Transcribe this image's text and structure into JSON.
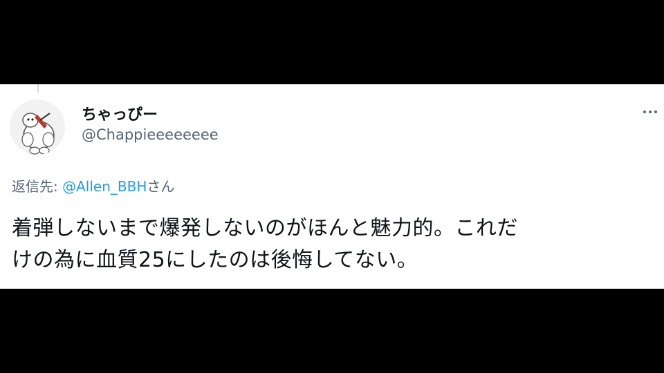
{
  "tweet": {
    "display_name": "ちゃっぴー",
    "handle": "@Chappieeeeeeee",
    "reply_prefix": "返信先: ",
    "reply_mention": "@Allen_BBH",
    "reply_suffix": "さん",
    "text_lines": [
      "着弾しないまで爆発しないのがほんと魅力的。これだ",
      "けの為に血質25にしたのは後悔してない。"
    ]
  },
  "colors": {
    "background": "#000000",
    "card": "#ffffff",
    "text_primary": "#0f1419",
    "text_secondary": "#536471",
    "link": "#1d9bf0"
  },
  "icons": {
    "more": "more-horizontal-icon",
    "avatar": "avatar-image"
  }
}
